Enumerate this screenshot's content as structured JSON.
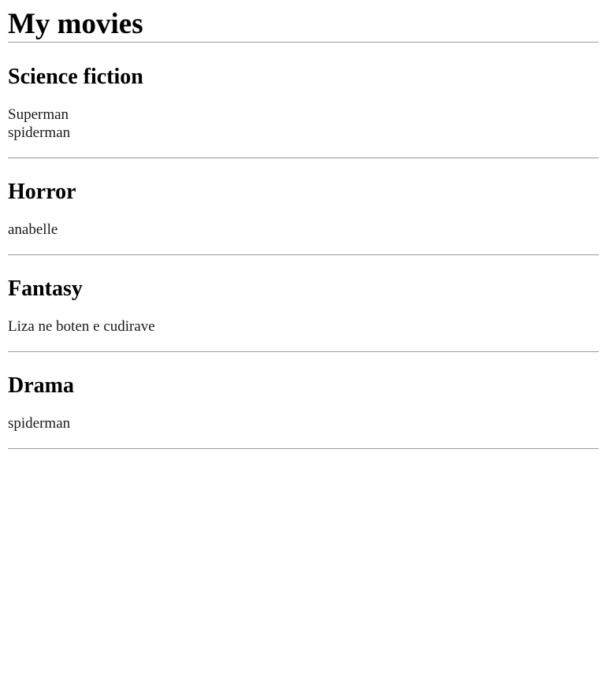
{
  "page": {
    "title": "My movies"
  },
  "genres": [
    {
      "name": "Science fiction",
      "movies": [
        "Superman",
        "spiderman"
      ]
    },
    {
      "name": "Horror",
      "movies": [
        "anabelle"
      ]
    },
    {
      "name": "Fantasy",
      "movies": [
        "Liza ne boten e cudirave"
      ]
    },
    {
      "name": "Drama",
      "movies": [
        "spiderman"
      ]
    }
  ],
  "colors": {
    "divider": "#9a9a9a",
    "text": "#000000"
  }
}
